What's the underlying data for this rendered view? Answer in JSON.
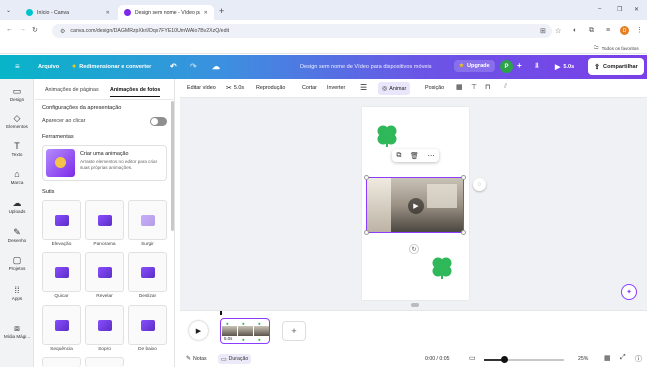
{
  "browser": {
    "tabs": [
      {
        "title": "Início - Canva"
      },
      {
        "title": "Design sem nome - Vídeo para"
      }
    ],
    "url": "canva.com/design/DAGMRzpXkrI/Dqx7FYE10UmWAlo7Bv2XzQ/edit",
    "bookmarks_label": "Todos os favoritos",
    "profile_initial": "D"
  },
  "header": {
    "file": "Arquivo",
    "resize": "Redimensionar e converter",
    "title": "Design sem nome de Vídeo para dispositivos móveis",
    "upgrade": "Upgrade",
    "avatar_initial": "P",
    "duration": "5.0s",
    "share": "Compartilhar"
  },
  "rail": [
    {
      "label": "Design",
      "icon": "layout-icon"
    },
    {
      "label": "Elementos",
      "icon": "shapes-icon"
    },
    {
      "label": "Texto",
      "icon": "text-icon"
    },
    {
      "label": "Marca",
      "icon": "brand-icon"
    },
    {
      "label": "Uploads",
      "icon": "cloud-upload-icon"
    },
    {
      "label": "Desenho",
      "icon": "draw-icon"
    },
    {
      "label": "Projetos",
      "icon": "folder-icon"
    },
    {
      "label": "Apps",
      "icon": "apps-grid-icon"
    },
    {
      "label": "Mídia Mági...",
      "icon": "magic-media-icon"
    }
  ],
  "panel": {
    "tabs": [
      "Animações de páginas",
      "Animações de fotos"
    ],
    "presentation_heading": "Configurações da apresentação",
    "appear_on_click": "Aparecer ao clicar",
    "tools_heading": "Ferramentas",
    "create_title": "Criar uma animação",
    "create_desc": "Arraste elementos no editor para criar suas próprias animações.",
    "subtle_heading": "Sutis",
    "presets": [
      {
        "label": "Elevação"
      },
      {
        "label": "Panorama"
      },
      {
        "label": "Surgir"
      },
      {
        "label": "Quicar"
      },
      {
        "label": "Revelar"
      },
      {
        "label": "Deslizar"
      },
      {
        "label": "Sequência"
      },
      {
        "label": "Sopro"
      },
      {
        "label": "De baixo"
      }
    ]
  },
  "toolbar": {
    "edit_video": "Editar vídeo",
    "clip_duration": "5.0s",
    "playback": "Reprodução",
    "crop": "Cortar",
    "flip": "Inverter",
    "animate": "Animar",
    "position": "Posição"
  },
  "timeline": {
    "clip_duration": "5.0s"
  },
  "footer": {
    "notes": "Notas",
    "duration": "Duração",
    "time": "0:00 / 0:05",
    "zoom": "25%",
    "zoom_level": 0.25
  },
  "colors": {
    "accent": "#8b3dff",
    "clover": "#2fb85a",
    "upgrade_star": "#f7c600"
  }
}
